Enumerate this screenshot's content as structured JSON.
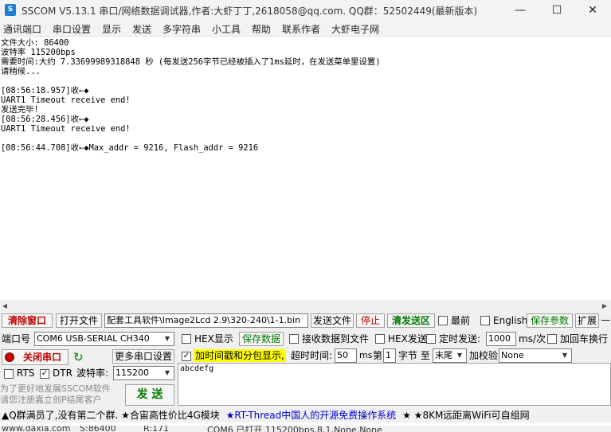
{
  "window": {
    "icon_text": "S",
    "title": "SSCOM V5.13.1 串口/网络数据调试器,作者:大虾丁丁,2618058@qq.com. QQ群：52502449(最新版本)",
    "minimize": "—",
    "maximize": "☐",
    "close": "✕"
  },
  "menu": [
    "通讯端口",
    "串口设置",
    "显示",
    "发送",
    "多字符串",
    "小工具",
    "帮助",
    "联系作者",
    "大虾电子网"
  ],
  "terminal": {
    "lines": [
      "文件大小: 86400",
      "波特率 115200bps",
      "需要时间:大约 7.33699989318848 秒 (每发送256字节已经被插入了1ms延时，在发送菜单里设置)",
      "请稍候...",
      "",
      "[08:56:18.957]收←◆",
      "UART1 Timeout receive end!",
      "发送完毕!",
      "[08:56:28.456]收←◆",
      "UART1 Timeout receive end!",
      "",
      "[08:56:44.708]收←◆Max_addr = 9216, Flash_addr = 9216"
    ]
  },
  "row1": {
    "clear_window": "清除窗口",
    "open_file": "打开文件",
    "file_path": "配套工具软件\\Image2Lcd 2.9\\320-240\\1-1.bin",
    "send_file": "发送文件",
    "stop": "停止",
    "clear_send_area": "清发送区",
    "topmost": "最前",
    "english": "English",
    "save_params": "保存参数",
    "expand": "扩展",
    "collapse": "—"
  },
  "row2": {
    "port_label": "端口号",
    "port_value": "COM6 USB-SERIAL CH340",
    "hex_display": "HEX显示",
    "save_data": "保存数据",
    "recv_to_file": "接收数据到文件",
    "hex_send": "HEX发送",
    "timed_send": "定时发送:",
    "interval": "1000",
    "interval_unit": "ms/次",
    "add_crlf": "加回车换行"
  },
  "row3": {
    "close_port": "关闭串口",
    "more_settings": "更多串口设置",
    "timestamp": "加时间戳和分包显示,",
    "timeout_label": "超时时间:",
    "timeout_value": "50",
    "timeout_unit": "ms",
    "byte_no_label": "第",
    "byte_no_value": "1",
    "byte_label": "字节 至",
    "end_value": "末尾",
    "checksum_label": "加校验",
    "checksum_value": "None"
  },
  "row4": {
    "rts": "RTS",
    "dtr": "DTR",
    "baud_label": "波特率:",
    "baud_value": "115200",
    "send_text": "abcdefg"
  },
  "row5": {
    "promo": "为了更好地发展SSCOM软件\n请您注册嘉立创P结尾客户",
    "send": "发 送"
  },
  "ticker": {
    "text1": "▲Q群满员了,没有第二个群. ★合宙高性价比4G模块",
    "text2": "★RT-Thread中国人的开源免费操作系统",
    "text3": "★ ★8KM远距离WiFi可自组网"
  },
  "statusbar": {
    "url": "www.daxia.com",
    "sent": "S:86400",
    "received": "R:171",
    "port_status": "COM6 已打开  115200bps,8,1,None,None"
  },
  "colors": {
    "red": "#c00000",
    "green": "#007a00",
    "highlight": "#ffff00",
    "link_blue": "#0000cc"
  }
}
